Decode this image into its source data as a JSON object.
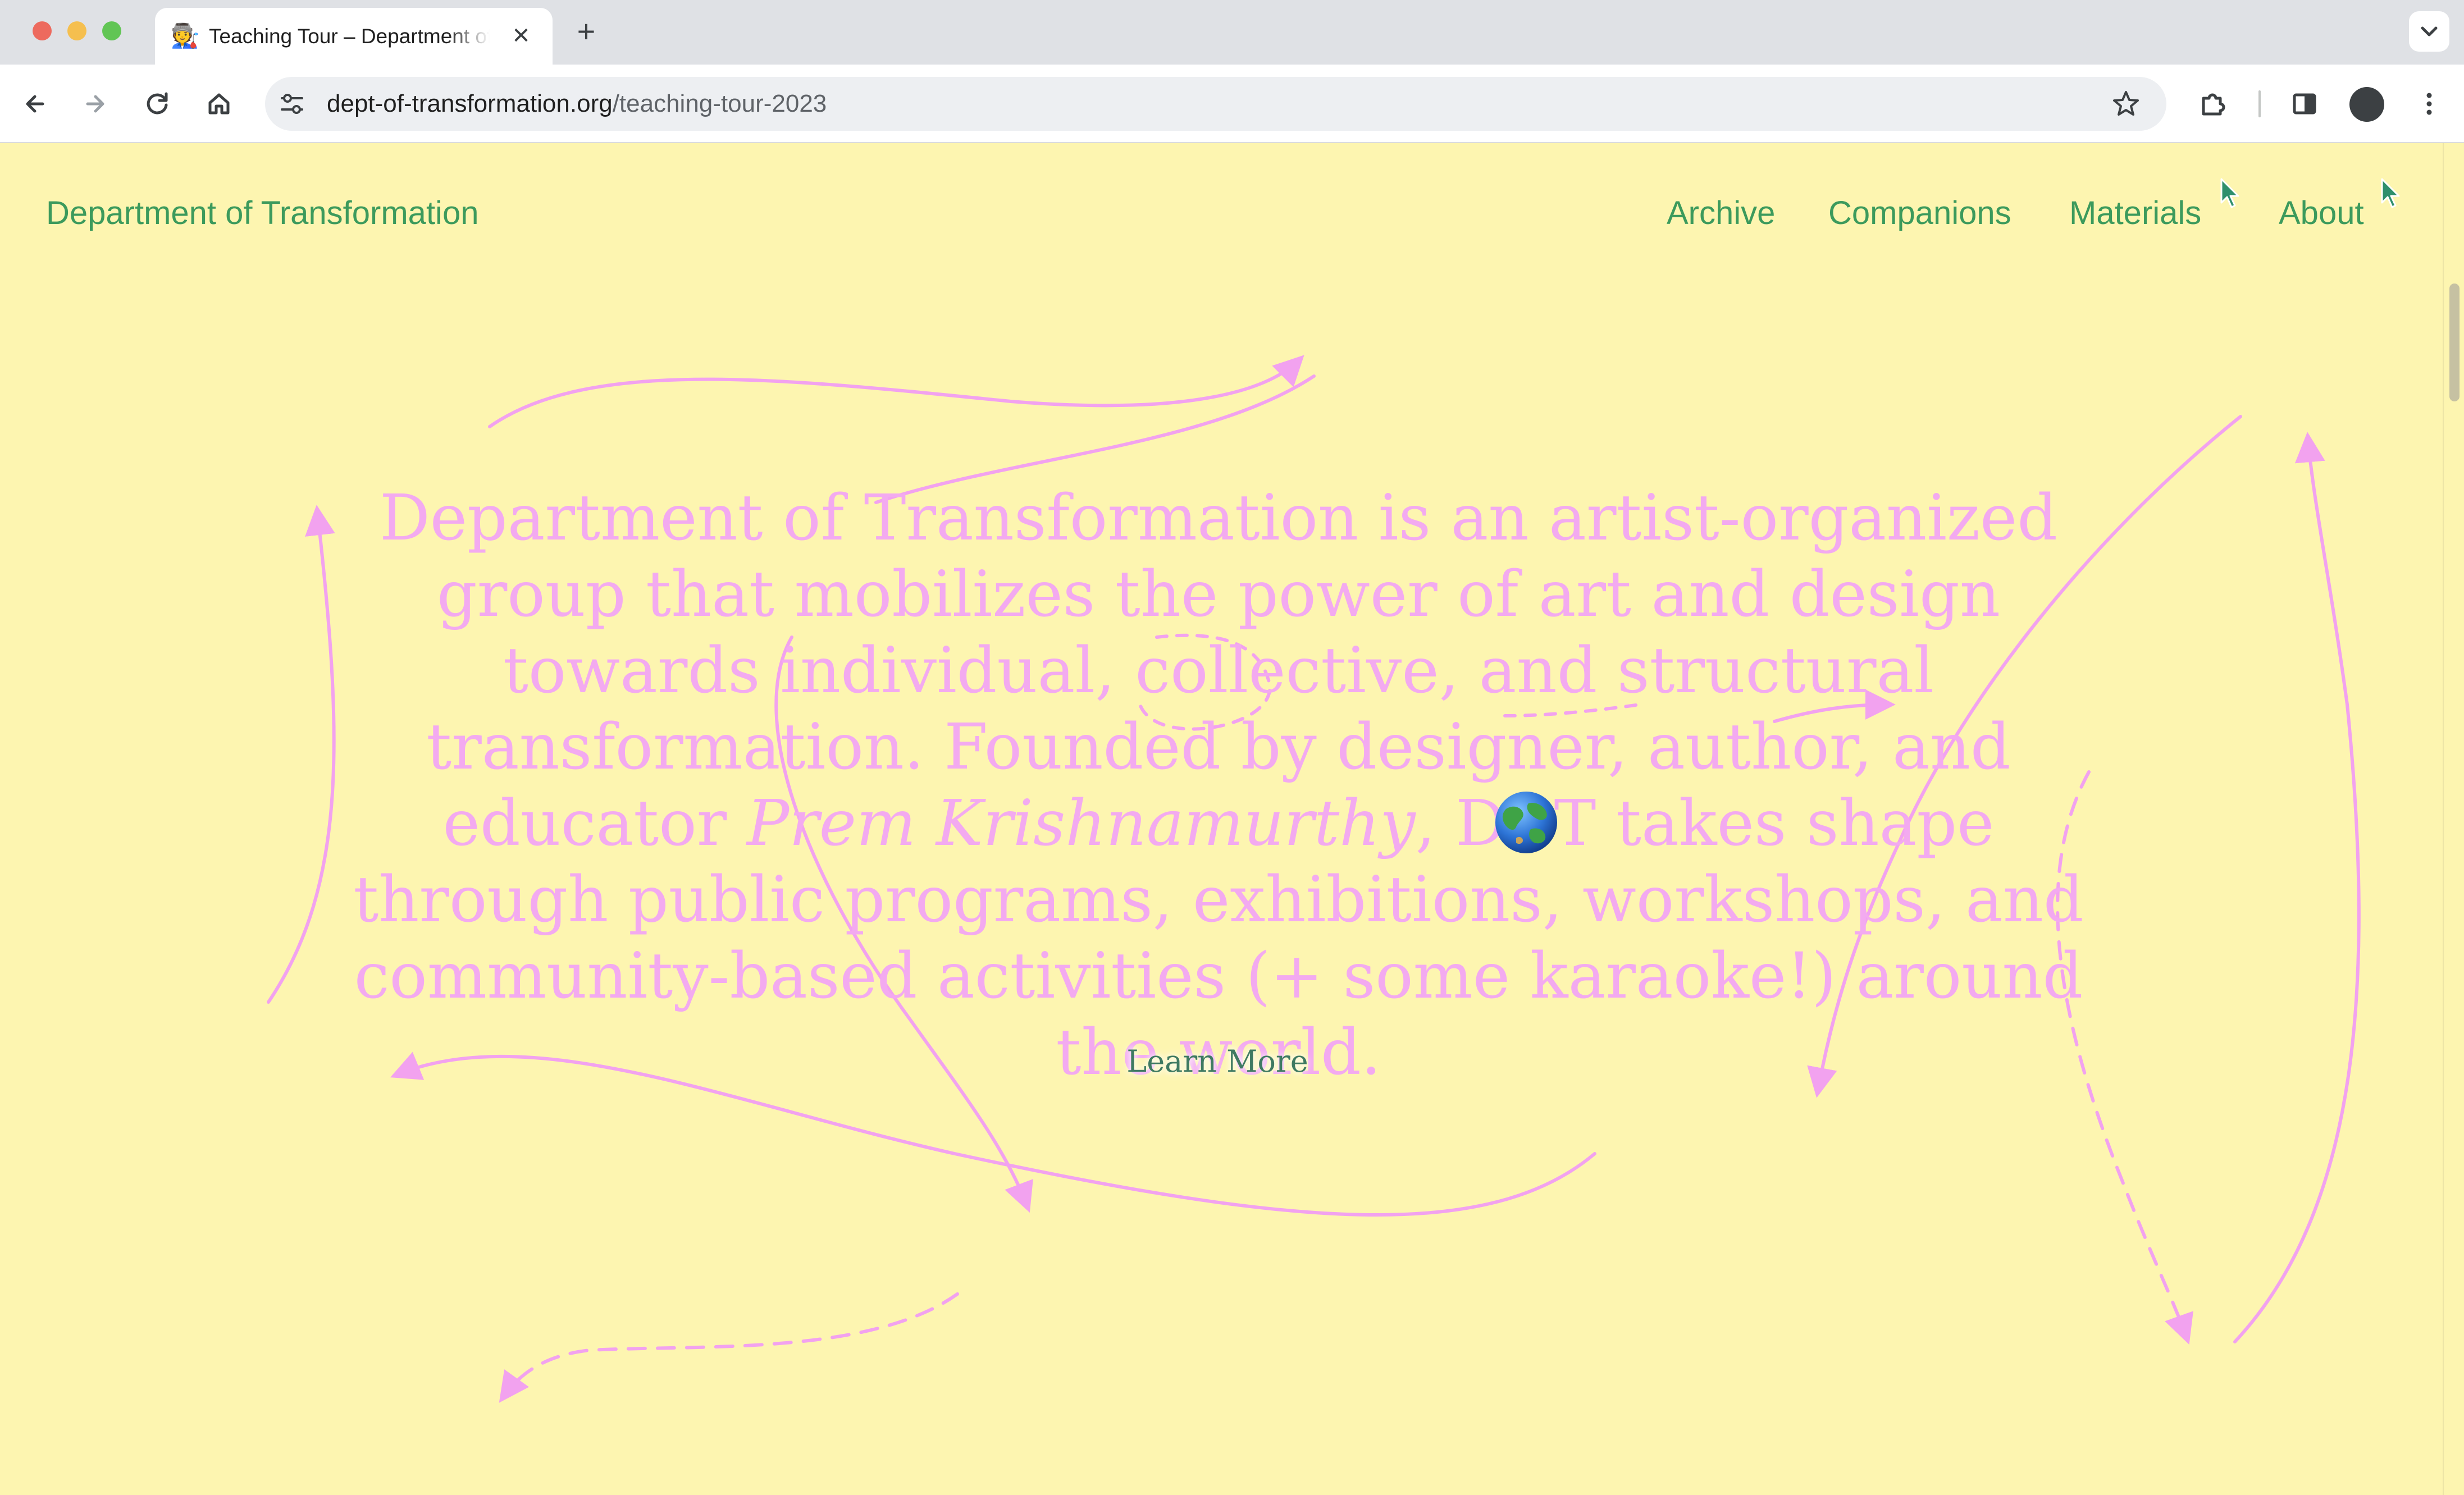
{
  "browser": {
    "tab": {
      "favicon": "🧑‍🏭",
      "title": "Teaching Tour – Department of Transformation"
    },
    "new_tab_label": "+",
    "tab_close_label": "✕",
    "address": {
      "host": "dept-of-transformation.org",
      "path": "/teaching-tour-2023"
    },
    "icons": [
      "back-icon",
      "forward-icon",
      "reload-icon",
      "home-icon",
      "site-settings-icon",
      "bookmark-star-icon",
      "extensions-icon",
      "side-panel-icon",
      "profile-avatar",
      "more-menu-icon",
      "tab-search-chevron-icon"
    ]
  },
  "site": {
    "title": "Department of Transformation",
    "nav": [
      {
        "label": "Archive"
      },
      {
        "label": "Companions"
      },
      {
        "label": "Materials"
      },
      {
        "label": "About"
      }
    ]
  },
  "hero": {
    "part1": "Department of Transformation is an artist-organized group that mobilizes the power of art and design towards individual, collective, and structural transformation. Founded by designer, author, and educator ",
    "founder": "Prem Krishnamurthy",
    "part2": ", D",
    "part3": "T takes shape through public programs, exhibitions, workshops, and community-based activities (+ some karaoke!) around the world.",
    "learn_more": "Learn More"
  },
  "colors": {
    "page_background": "#fdf5b0",
    "site_green": "#3c9a5c",
    "hero_pink": "#f3aaf0",
    "doodle_pink": "#f2a2ef",
    "learn_more_teal": "#3f7a62"
  }
}
